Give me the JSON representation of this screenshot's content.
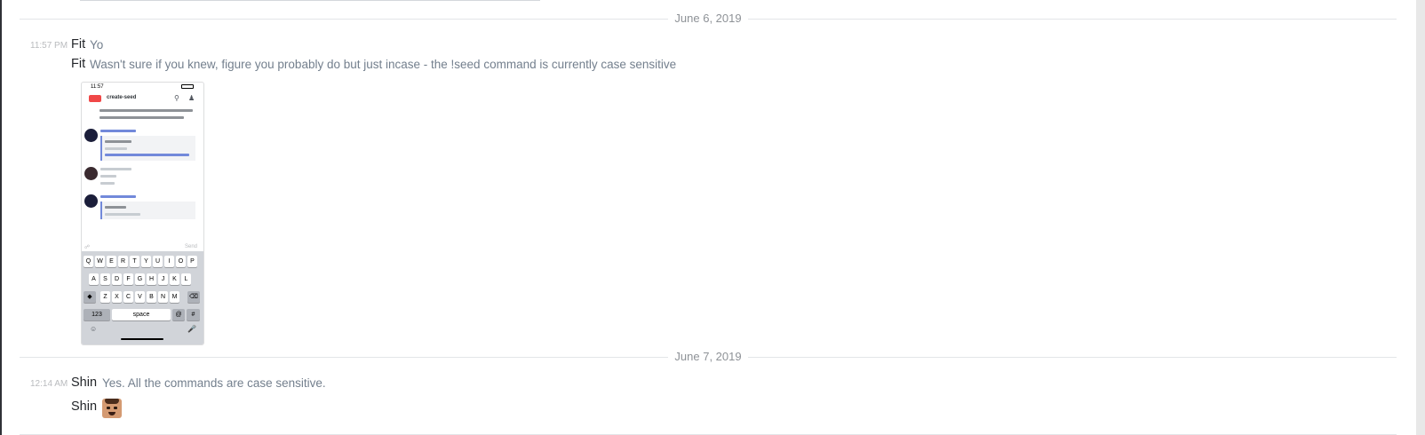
{
  "dividers": {
    "first": "June 6, 2019",
    "second": "June 7, 2019"
  },
  "messages": [
    {
      "timestamp": "11:57 PM",
      "author": "Fit",
      "text": "Yo"
    },
    {
      "author": "Fit",
      "text": "Wasn't sure if you knew, figure you probably do but just incase - the !seed command is currently case sensitive"
    },
    {
      "timestamp": "12:14 AM",
      "author": "Shin",
      "text": "Yes. All the commands are case sensitive."
    },
    {
      "author": "Shin",
      "emoji": "face-emoji"
    }
  ],
  "attachment": {
    "status_time": "11:57",
    "channel": "create-seed",
    "send_label": "Send",
    "keyboard": {
      "row1": [
        "Q",
        "W",
        "E",
        "R",
        "T",
        "Y",
        "U",
        "I",
        "O",
        "P"
      ],
      "row2": [
        "A",
        "S",
        "D",
        "F",
        "G",
        "H",
        "J",
        "K",
        "L"
      ],
      "row3": [
        "Z",
        "X",
        "C",
        "V",
        "B",
        "N",
        "M"
      ],
      "numbers_key": "123",
      "space_key": "space",
      "at_key": "@",
      "hash_key": "#"
    }
  },
  "colors": {
    "divider_text": "#8e9297",
    "message_text": "#737f8d",
    "author": "#23262a",
    "accent": "#7289da"
  }
}
